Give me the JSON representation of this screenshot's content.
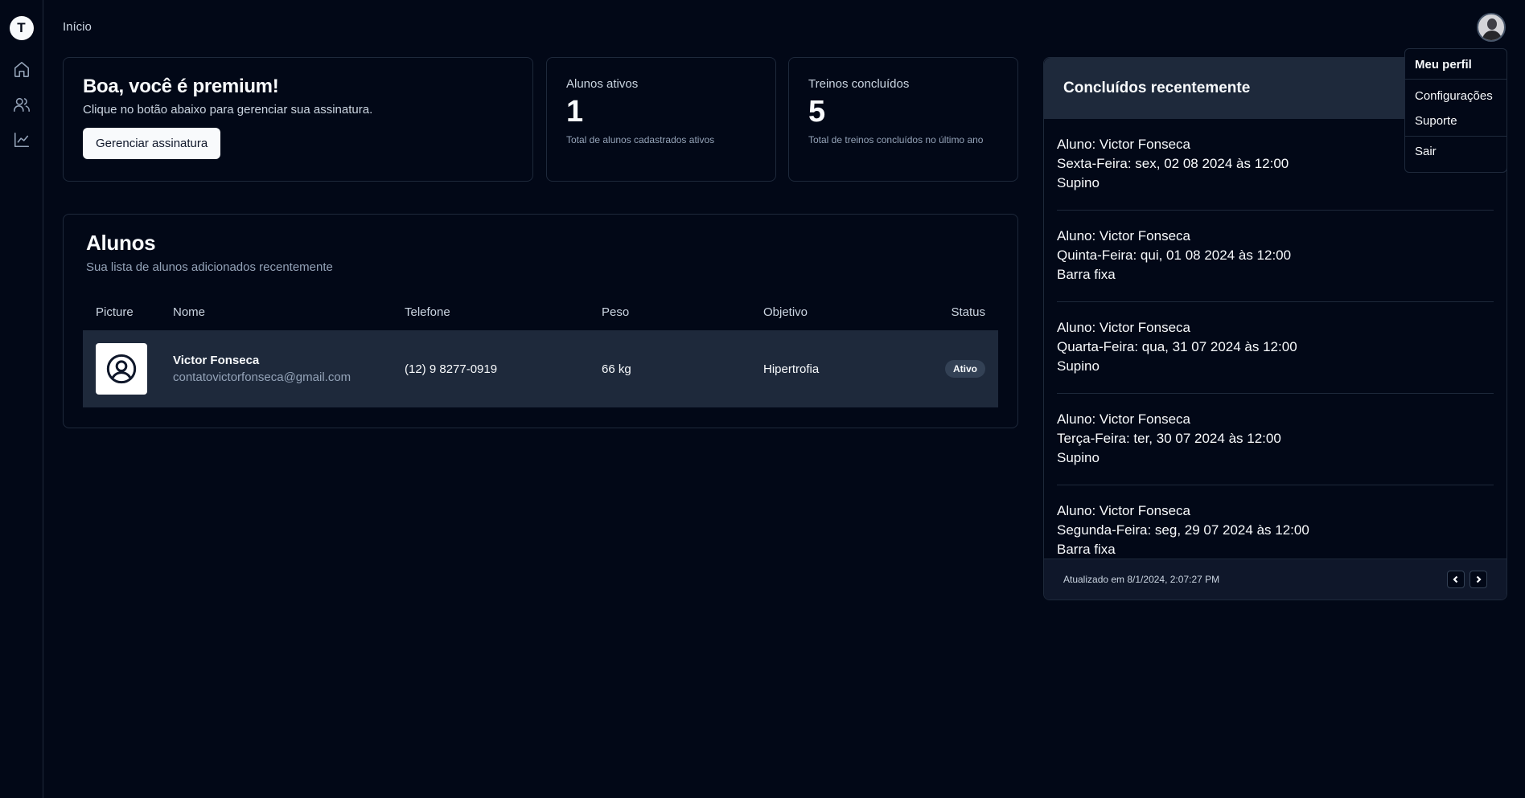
{
  "sidebar": {
    "brand_letter": "T",
    "items": [
      "home-icon",
      "users-icon",
      "chart-icon"
    ]
  },
  "header": {
    "breadcrumb": "Início"
  },
  "premium": {
    "title": "Boa, você é premium!",
    "subtitle": "Clique no botão abaixo para gerenciar sua assinatura.",
    "button_label": "Gerenciar assinatura"
  },
  "stats": [
    {
      "label": "Alunos ativos",
      "value": "1",
      "desc": "Total de alunos cadastrados ativos"
    },
    {
      "label": "Treinos concluídos",
      "value": "5",
      "desc": "Total de treinos concluídos no último ano"
    }
  ],
  "alunos": {
    "title": "Alunos",
    "subtitle": "Sua lista de alunos adicionados recentemente",
    "columns": [
      "Picture",
      "Nome",
      "Telefone",
      "Peso",
      "Objetivo",
      "Status"
    ],
    "rows": [
      {
        "name": "Victor Fonseca",
        "email": "contatovictorfonseca@gmail.com",
        "phone": "(12) 9 8277-0919",
        "weight": "66 kg",
        "goal": "Hipertrofia",
        "status": "Ativo"
      }
    ]
  },
  "recent": {
    "title": "Concluídos recentemente",
    "items": [
      {
        "student": "Aluno: Victor Fonseca",
        "date": "Sexta-Feira: sex, 02 08 2024 às 12:00",
        "exercise": "Supino"
      },
      {
        "student": "Aluno: Victor Fonseca",
        "date": "Quinta-Feira: qui, 01 08 2024 às 12:00",
        "exercise": "Barra fixa"
      },
      {
        "student": "Aluno: Victor Fonseca",
        "date": "Quarta-Feira: qua, 31 07 2024 às 12:00",
        "exercise": "Supino"
      },
      {
        "student": "Aluno: Victor Fonseca",
        "date": "Terça-Feira: ter, 30 07 2024 às 12:00",
        "exercise": "Supino"
      },
      {
        "student": "Aluno: Victor Fonseca",
        "date": "Segunda-Feira: seg, 29 07 2024 às 12:00",
        "exercise": "Barra fixa"
      }
    ],
    "updated": "Atualizado em 8/1/2024, 2:07:27 PM"
  },
  "menu": {
    "label": "Meu perfil",
    "items": [
      "Configurações",
      "Suporte"
    ],
    "logout": "Sair"
  },
  "colors": {
    "background": "#020817",
    "border": "#1e293b",
    "row_bg": "#1e293b",
    "text": "#f8fafc",
    "muted": "#94a3b8"
  }
}
